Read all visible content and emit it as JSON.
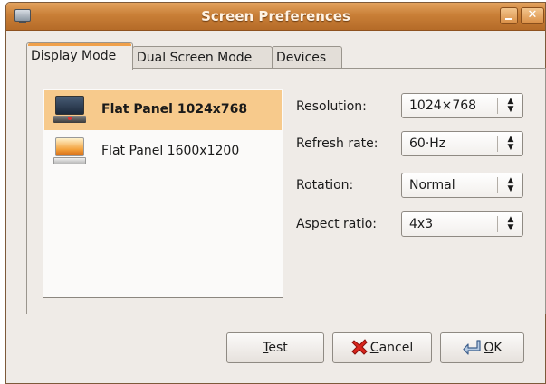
{
  "window": {
    "title": "Screen Preferences"
  },
  "tabs": [
    {
      "label": "Display Mode",
      "active": true
    },
    {
      "label": "Dual Screen Mode",
      "active": false
    },
    {
      "label": "Devices",
      "active": false
    }
  ],
  "monitors": [
    {
      "label": "Flat Panel 1024x768",
      "selected": true,
      "icon": "laptop-monitor-icon"
    },
    {
      "label": "Flat Panel 1600x1200",
      "selected": false,
      "icon": "flat-panel-monitor-icon"
    }
  ],
  "settings": {
    "resolution": {
      "label": "Resolution:",
      "value": "1024×768"
    },
    "refresh": {
      "label": "Refresh rate:",
      "value": "60·Hz"
    },
    "rotation": {
      "label": "Rotation:",
      "value": "Normal"
    },
    "aspect": {
      "label": "Aspect ratio:",
      "value": "4x3"
    }
  },
  "buttons": {
    "test_first": "T",
    "test_rest": "est",
    "cancel_first": "C",
    "cancel_rest": "ancel",
    "ok_first": "O",
    "ok_rest": "K"
  },
  "colors": {
    "accent": "#f0a04a",
    "selection": "#f7ca8c",
    "titlebar": "#c97f37"
  }
}
